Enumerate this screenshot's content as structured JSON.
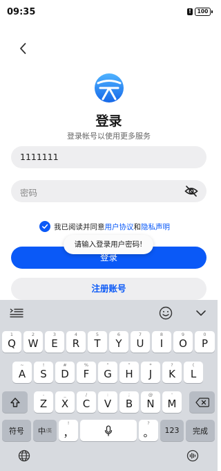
{
  "status": {
    "time": "09:35",
    "battery": "100"
  },
  "header": {
    "title": "登录",
    "subtitle": "登录帐号以使用更多服务"
  },
  "account": {
    "value": "1111111"
  },
  "password": {
    "placeholder": "密码"
  },
  "agreement": {
    "prefix": "我已阅读并同意",
    "link1": "用户协议",
    "conjunction": "和",
    "link2": "隐私声明",
    "checked": true
  },
  "buttons": {
    "login": "登录",
    "register": "注册账号"
  },
  "toast": {
    "text": "请输入登录用户密码!"
  },
  "keyboard": {
    "row1": [
      {
        "label": "Q",
        "sub": "1"
      },
      {
        "label": "W",
        "sub": "2"
      },
      {
        "label": "E",
        "sub": "3"
      },
      {
        "label": "R",
        "sub": "4"
      },
      {
        "label": "T",
        "sub": "5"
      },
      {
        "label": "Y",
        "sub": "6"
      },
      {
        "label": "U",
        "sub": "7"
      },
      {
        "label": "I",
        "sub": "8"
      },
      {
        "label": "O",
        "sub": "9"
      },
      {
        "label": "P",
        "sub": "0"
      }
    ],
    "row2": [
      {
        "label": "A",
        "sub": "~"
      },
      {
        "label": "S",
        "sub": "!"
      },
      {
        "label": "D",
        "sub": "#"
      },
      {
        "label": "F",
        "sub": "%"
      },
      {
        "label": "G",
        "sub": "“"
      },
      {
        "label": "H",
        "sub": "”"
      },
      {
        "label": "J",
        "sub": "*"
      },
      {
        "label": "K",
        "sub": "?"
      },
      {
        "label": "L",
        "sub": "("
      }
    ],
    "row3": [
      {
        "label": "Z",
        "sub": "-"
      },
      {
        "label": "X",
        "sub": "_"
      },
      {
        "label": "C",
        "sub": "/"
      },
      {
        "label": "V",
        "sub": ":"
      },
      {
        "label": "B",
        "sub": ";"
      },
      {
        "label": "N",
        "sub": "@"
      },
      {
        "label": "M",
        "sub": "'"
      }
    ],
    "symbol_key": "符号",
    "lang_key": "中",
    "lang_key_sub": "/英",
    "comma_key": "，",
    "comma_sub": "!",
    "period_key": "。",
    "period_sub": "?",
    "num_key": "123",
    "done_key": "完成"
  }
}
